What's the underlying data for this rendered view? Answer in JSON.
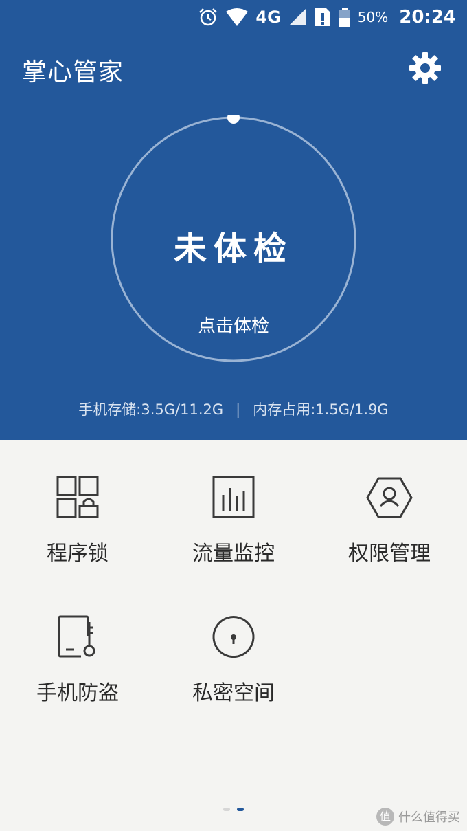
{
  "status_bar": {
    "network": "4G",
    "battery": "50%",
    "time": "20:24"
  },
  "header": {
    "title": "掌心管家"
  },
  "checkup": {
    "status": "未体检",
    "action": "点击体检"
  },
  "stats": {
    "storage": "手机存储:3.5G/11.2G",
    "separator": "|",
    "memory": "内存占用:1.5G/1.9G"
  },
  "features": [
    {
      "label": "程序锁",
      "icon": "app-lock-icon"
    },
    {
      "label": "流量监控",
      "icon": "traffic-chart-icon"
    },
    {
      "label": "权限管理",
      "icon": "permission-user-icon"
    },
    {
      "label": "手机防盗",
      "icon": "phone-key-icon"
    },
    {
      "label": "私密空间",
      "icon": "private-lock-icon"
    }
  ],
  "pager": {
    "pages": 2,
    "active": 2
  },
  "watermark": {
    "text": "什么值得买",
    "badge": "值"
  },
  "colors": {
    "primary": "#23589b",
    "background": "#f4f4f2",
    "icon": "#3a3a3a"
  }
}
